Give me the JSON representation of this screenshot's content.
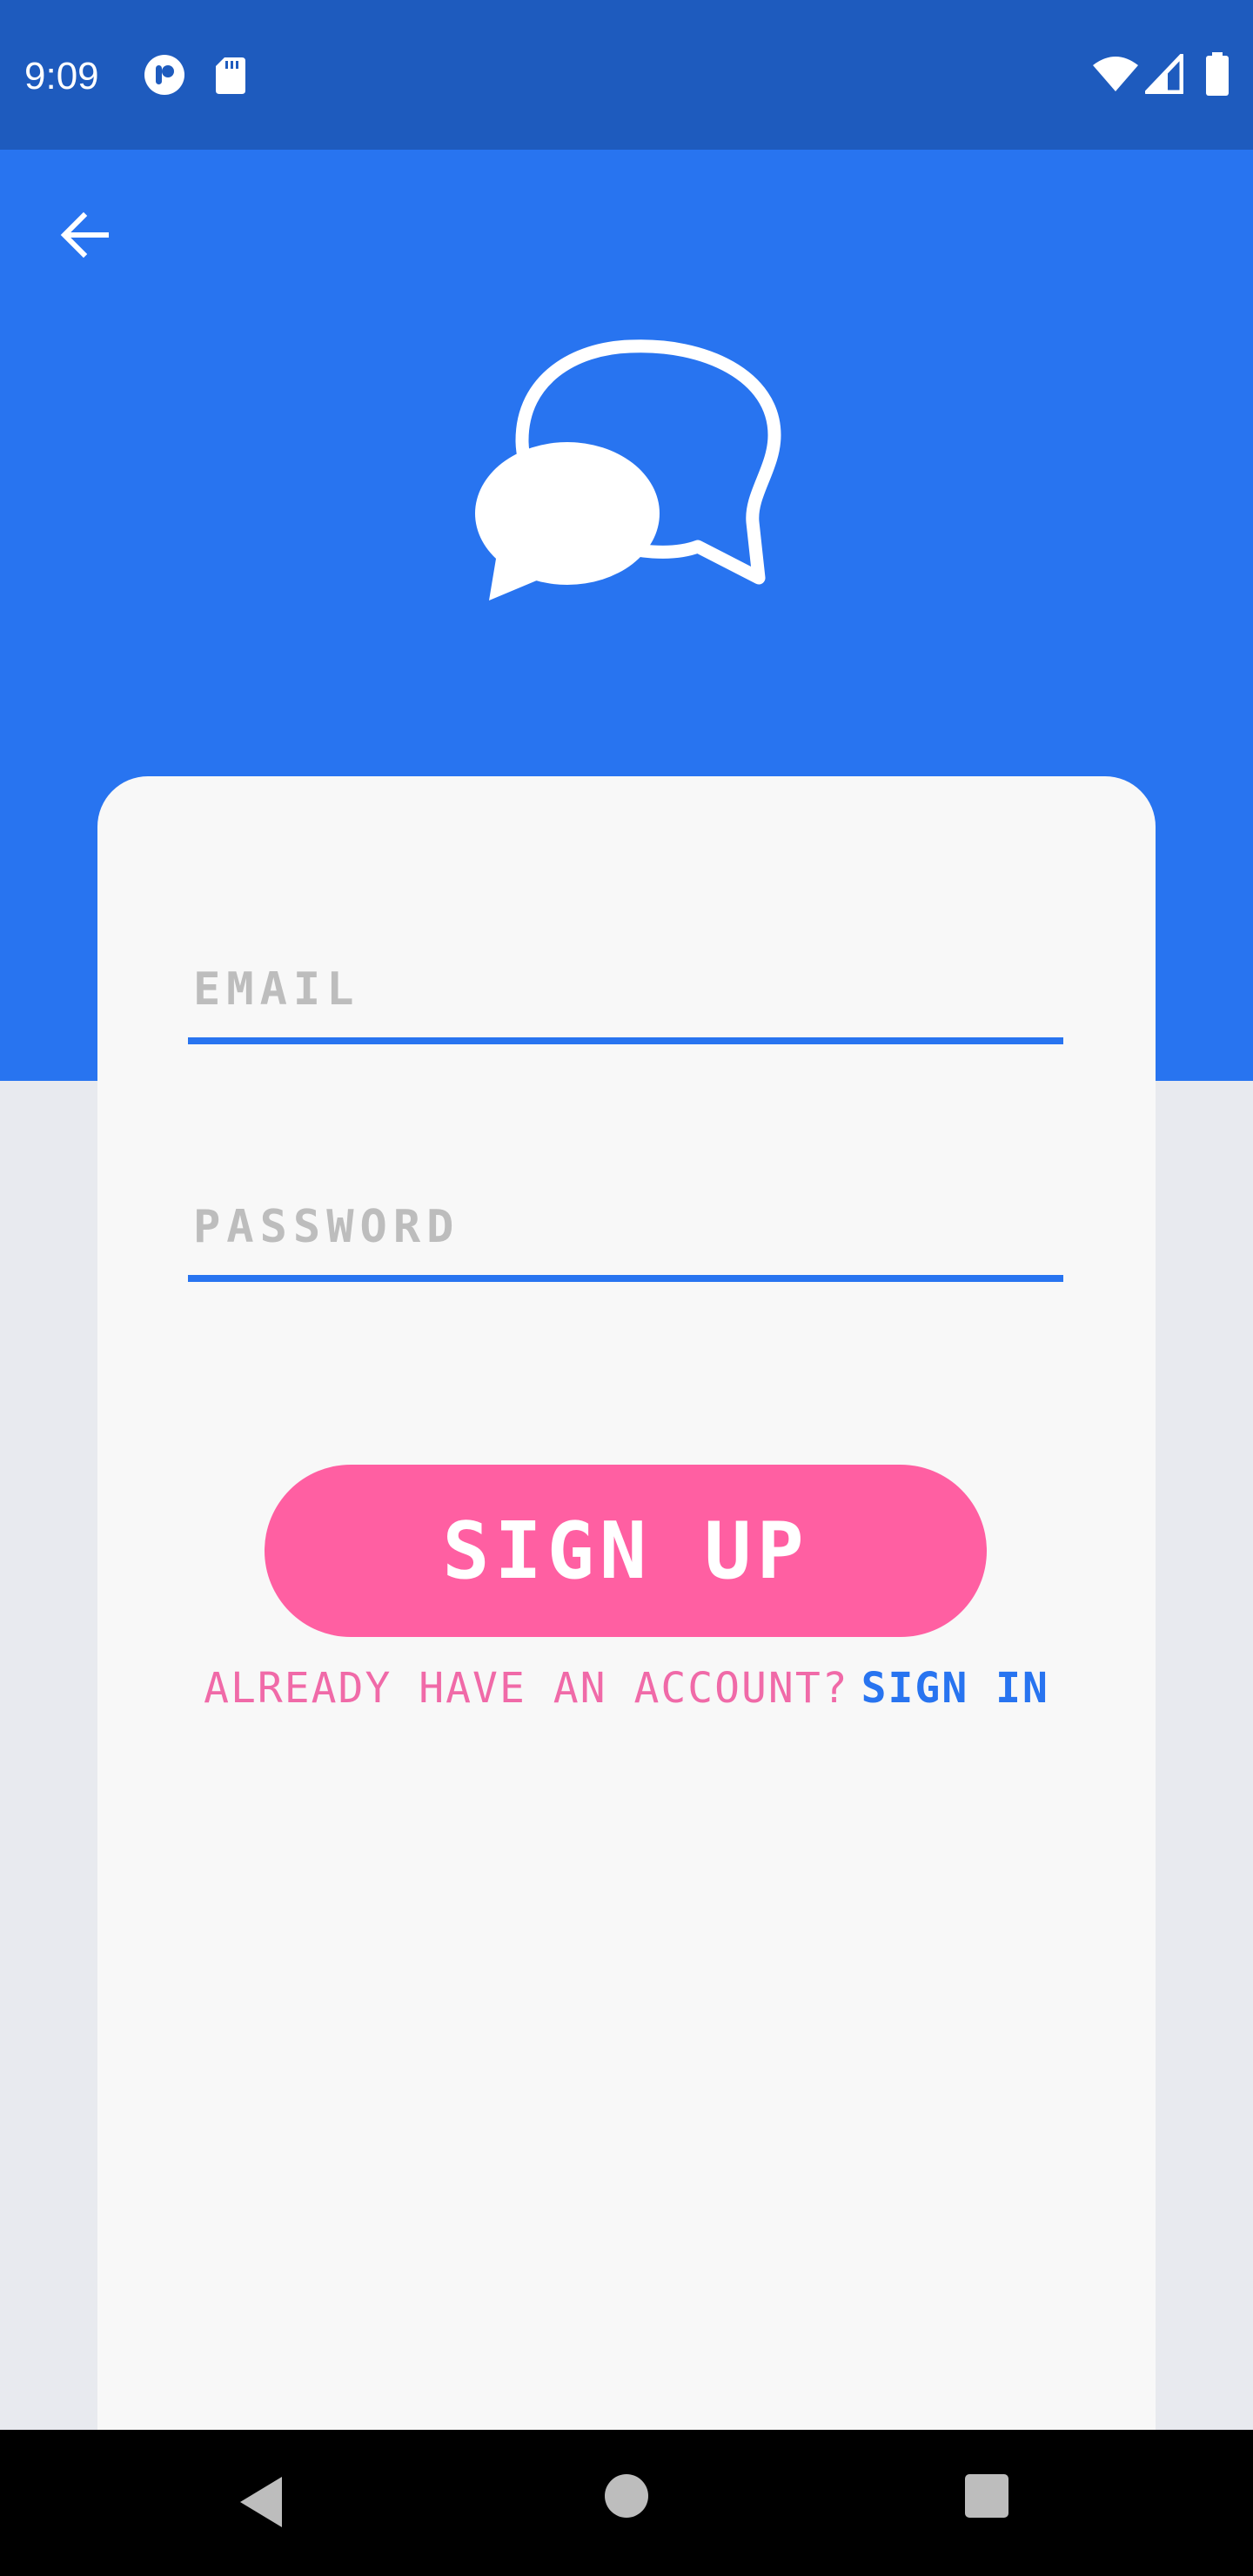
{
  "status_bar": {
    "time": "9:09",
    "left_icons": [
      "pocket-casts-icon",
      "sd-card-icon"
    ],
    "right_icons": [
      "wifi-icon",
      "cellular-signal-icon",
      "battery-icon"
    ]
  },
  "header": {
    "back_icon": "arrow-left-icon",
    "logo_icon": "chat-bubbles-icon"
  },
  "form": {
    "email_placeholder": "EMAIL",
    "email_value": "",
    "password_placeholder": "PASSWORD",
    "password_value": "",
    "signup_label": "SIGN UP",
    "account_prompt": "ALREADY HAVE AN ACCOUNT?",
    "signin_label": "SIGN IN"
  },
  "nav_bar": {
    "icons": [
      "back-triangle-icon",
      "home-circle-icon",
      "recents-square-icon"
    ]
  },
  "colors": {
    "status_bar": "#1E5BBE",
    "primary": "#2874F0",
    "accent_pink": "#FF5FA2",
    "card": "#F8F8F8",
    "background": "#E8EAEF"
  }
}
